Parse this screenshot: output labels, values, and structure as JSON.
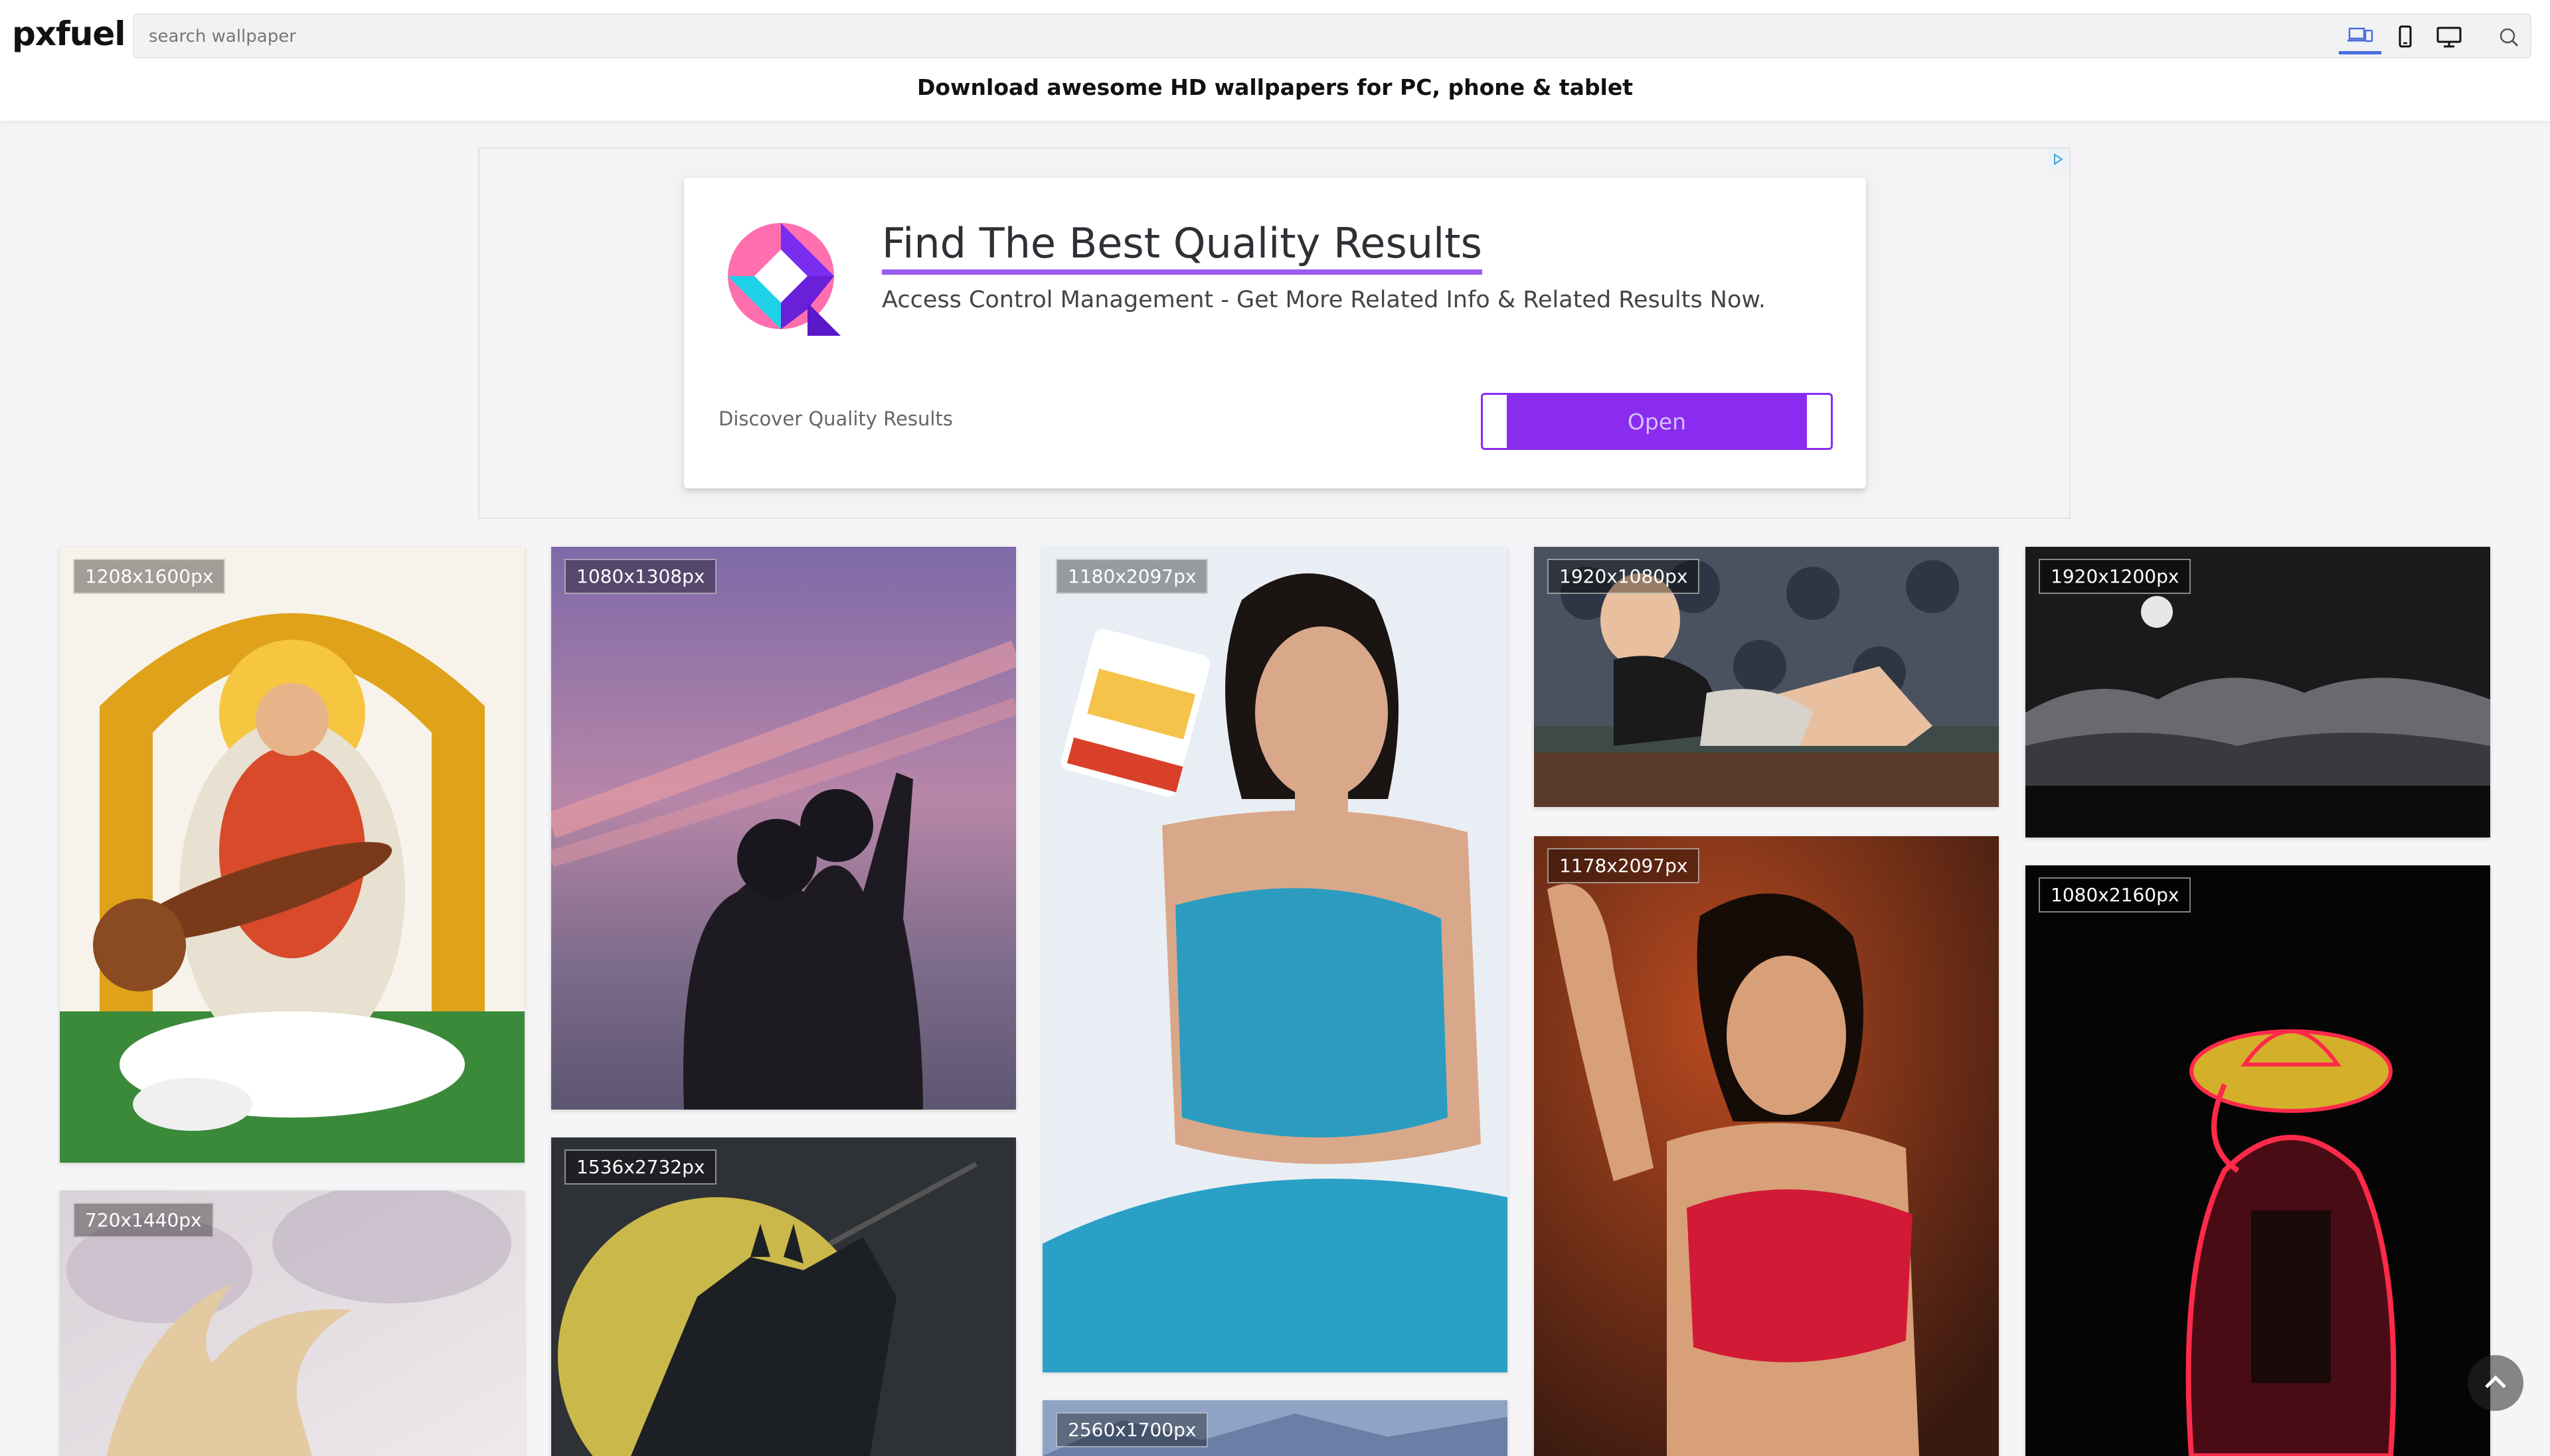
{
  "brand": {
    "logo": "pxfuel"
  },
  "search": {
    "placeholder": "search wallpaper",
    "value": ""
  },
  "device_filters": [
    {
      "name": "all-devices",
      "icon": "devices-icon",
      "active": true
    },
    {
      "name": "phone",
      "icon": "phone-icon",
      "active": false
    },
    {
      "name": "desktop",
      "icon": "desktop-icon",
      "active": false
    }
  ],
  "tagline": "Download awesome HD wallpapers for PC, phone & tablet",
  "ad": {
    "title": "Find The Best Quality Results",
    "description": "Access Control Management - Get More Related Info & Related Results Now.",
    "footer": "Discover Quality Results",
    "button": "Open",
    "accent": "#8a2cf0"
  },
  "wallpapers": [
    {
      "res": "1208x1600px",
      "theme": "goddess-veena"
    },
    {
      "res": "720x1440px",
      "theme": "anime-blur"
    },
    {
      "res": "1080x1308px",
      "theme": "couple-sunset"
    },
    {
      "res": "1536x2732px",
      "theme": "batman-moon"
    },
    {
      "res": "1180x2097px",
      "theme": "woman-peanut-butter"
    },
    {
      "res": "2560x1700px",
      "theme": "landscape"
    },
    {
      "res": "1920x1080px",
      "theme": "woman-sofa"
    },
    {
      "res": "1178x2097px",
      "theme": "woman-red-top"
    },
    {
      "res": "1920x1200px",
      "theme": "moon-clouds"
    },
    {
      "res": "1080x2160px",
      "theme": "pirate-silhouette"
    }
  ]
}
